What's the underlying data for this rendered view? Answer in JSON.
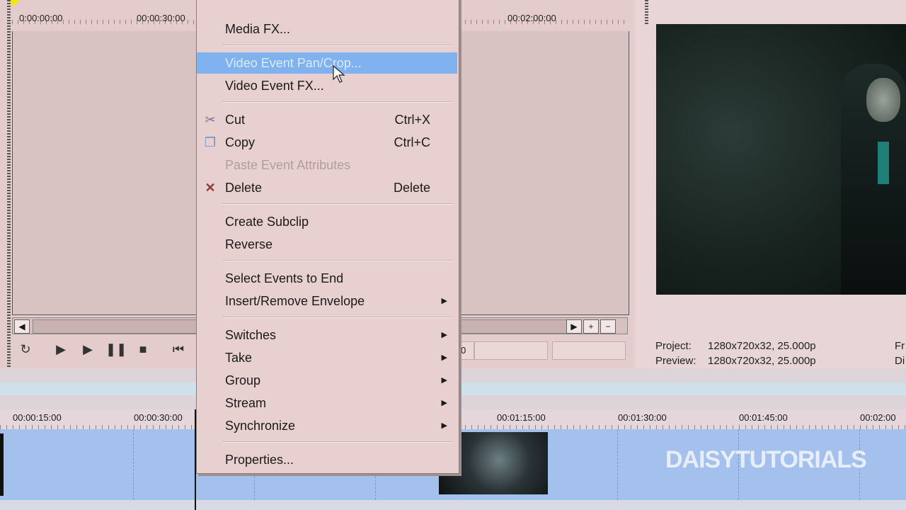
{
  "trimmer": {
    "ruler_times": [
      "0:00:00:00",
      "00:00:30:00",
      "00:02:00:00"
    ],
    "field_value": "0"
  },
  "preview": {
    "project_label": "Project:",
    "project_value": "1280x720x32, 25.000p",
    "preview_label": "Preview:",
    "preview_value": "1280x720x32, 25.000p",
    "right_top": "Fr",
    "right_bottom": "Di"
  },
  "timeline": {
    "ruler_times": [
      "00:00:15:00",
      "00:00:30:00",
      "00:01:15:00",
      "00:01:30:00",
      "00:01:45:00",
      "00:02:00"
    ],
    "watermark": "DAISYTUTORIALS"
  },
  "menu": {
    "items": [
      {
        "label": "Media FX...",
        "shortcut": "",
        "submenu": false,
        "icon": "",
        "state": "normal"
      },
      {
        "label": "Video Event Pan/Crop...",
        "shortcut": "",
        "submenu": false,
        "icon": "",
        "state": "highlighted"
      },
      {
        "label": "Video Event FX...",
        "shortcut": "",
        "submenu": false,
        "icon": "",
        "state": "normal"
      },
      {
        "label": "Cut",
        "shortcut": "Ctrl+X",
        "submenu": false,
        "icon": "scissors-icon",
        "state": "normal"
      },
      {
        "label": "Copy",
        "shortcut": "Ctrl+C",
        "submenu": false,
        "icon": "copy-icon",
        "state": "normal"
      },
      {
        "label": "Paste Event Attributes",
        "shortcut": "",
        "submenu": false,
        "icon": "",
        "state": "disabled"
      },
      {
        "label": "Delete",
        "shortcut": "Delete",
        "submenu": false,
        "icon": "delete-x-icon",
        "state": "normal"
      },
      {
        "label": "Create Subclip",
        "shortcut": "",
        "submenu": false,
        "icon": "",
        "state": "normal"
      },
      {
        "label": "Reverse",
        "shortcut": "",
        "submenu": false,
        "icon": "",
        "state": "normal"
      },
      {
        "label": "Select Events to End",
        "shortcut": "",
        "submenu": false,
        "icon": "",
        "state": "normal"
      },
      {
        "label": "Insert/Remove Envelope",
        "shortcut": "",
        "submenu": true,
        "icon": "",
        "state": "normal"
      },
      {
        "label": "Switches",
        "shortcut": "",
        "submenu": true,
        "icon": "",
        "state": "normal"
      },
      {
        "label": "Take",
        "shortcut": "",
        "submenu": true,
        "icon": "",
        "state": "normal"
      },
      {
        "label": "Group",
        "shortcut": "",
        "submenu": true,
        "icon": "",
        "state": "normal"
      },
      {
        "label": "Stream",
        "shortcut": "",
        "submenu": true,
        "icon": "",
        "state": "normal"
      },
      {
        "label": "Synchronize",
        "shortcut": "",
        "submenu": true,
        "icon": "",
        "state": "normal"
      },
      {
        "label": "Properties...",
        "shortcut": "",
        "submenu": false,
        "icon": "",
        "state": "normal"
      }
    ]
  },
  "colors": {
    "highlight": "#7fb2ee",
    "track": "#a4c1ee",
    "menu_bg": "#e8d0d0"
  }
}
